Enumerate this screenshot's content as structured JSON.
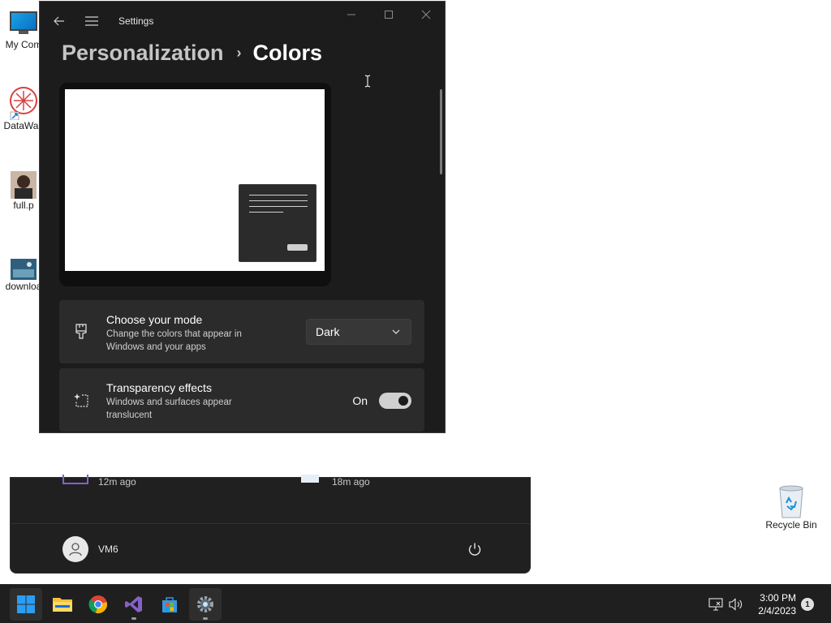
{
  "desktop": {
    "icons": [
      {
        "label": "My Com"
      },
      {
        "label": "DataWac"
      },
      {
        "label": "full.p"
      },
      {
        "label": "downloa"
      }
    ],
    "recycle_bin": {
      "label": "Recycle Bin"
    }
  },
  "settings": {
    "title": "Settings",
    "breadcrumb": {
      "parent": "Personalization",
      "separator": "›",
      "current": "Colors"
    },
    "mode_card": {
      "title": "Choose your mode",
      "description": "Change the colors that appear in Windows and your apps",
      "selected": "Dark"
    },
    "transparency_card": {
      "title": "Transparency effects",
      "description": "Windows and surfaces appear translucent",
      "state_label": "On",
      "enabled": true
    }
  },
  "start_menu": {
    "recent": [
      {
        "time": "12m ago"
      },
      {
        "time": "18m ago"
      }
    ],
    "user": {
      "name": "VM6"
    }
  },
  "taskbar": {
    "apps": [
      "start",
      "file-explorer",
      "chrome",
      "visual-studio",
      "microsoft-store",
      "settings"
    ],
    "clock": {
      "time": "3:00 PM",
      "date": "2/4/2023"
    },
    "notification_count": "1"
  }
}
